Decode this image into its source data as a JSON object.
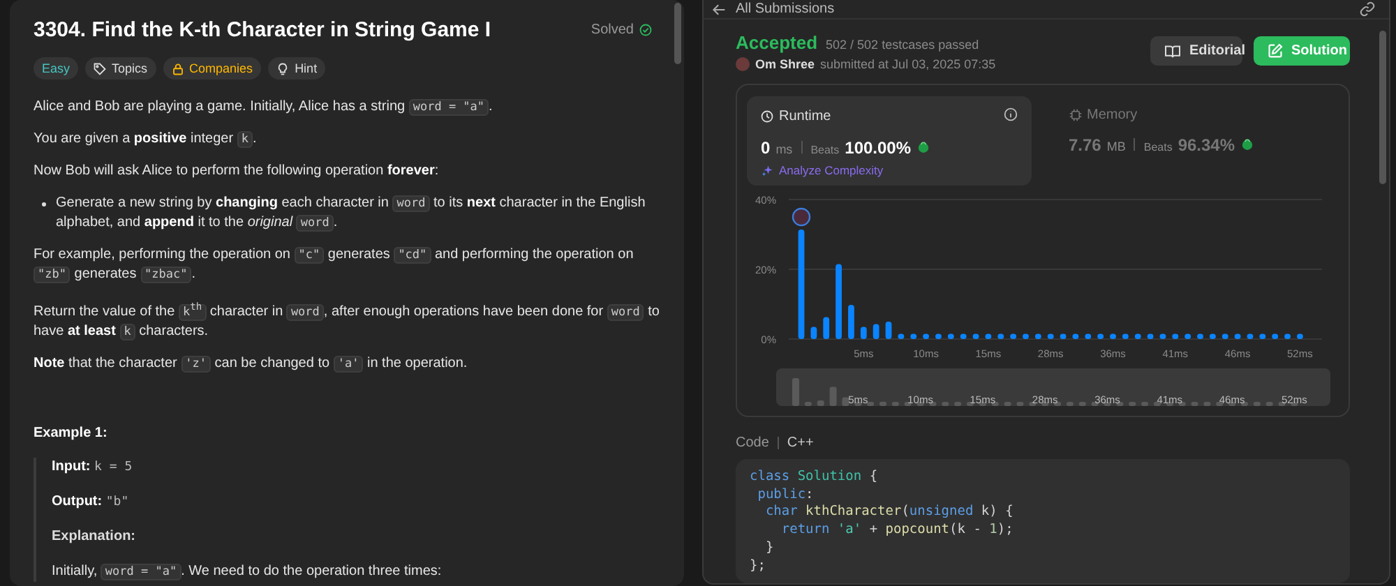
{
  "problem": {
    "title": "3304. Find the K-th Character in String Game I",
    "status": "Solved",
    "tags": [
      {
        "label": "Easy",
        "kind": "difficulty"
      },
      {
        "label": "Topics",
        "kind": "topics"
      },
      {
        "label": "Companies",
        "kind": "companies"
      },
      {
        "label": "Hint",
        "kind": "hint"
      }
    ],
    "description": [
      {
        "kind": "paragraph",
        "segments": [
          {
            "kind": "text",
            "text": "Alice and Bob are playing a game. Initially, Alice has a string "
          },
          {
            "kind": "code",
            "text": "word = \"a\""
          },
          {
            "kind": "text",
            "text": "."
          }
        ]
      },
      {
        "kind": "paragraph",
        "segments": [
          {
            "kind": "text",
            "text": "You are given a **positive** integer "
          },
          {
            "kind": "code",
            "text": "k"
          },
          {
            "kind": "text",
            "text": "."
          }
        ]
      },
      {
        "kind": "paragraph",
        "segments": [
          {
            "kind": "text",
            "text": "Now Bob will ask Alice to perform the following operation **forever**:"
          }
        ]
      },
      {
        "kind": "bullet",
        "segments": [
          {
            "kind": "text",
            "text": "Generate a new string by **changing** each character in "
          },
          {
            "kind": "code",
            "text": "word"
          },
          {
            "kind": "text",
            "text": " to its **next** character in the English alphabet, and **append** it to the *original* "
          },
          {
            "kind": "code",
            "text": "word"
          },
          {
            "kind": "text",
            "text": "."
          }
        ]
      },
      {
        "kind": "paragraph",
        "segments": [
          {
            "kind": "text",
            "text": "For example, performing the operation on "
          },
          {
            "kind": "code",
            "text": "\"c\""
          },
          {
            "kind": "text",
            "text": " generates "
          },
          {
            "kind": "code",
            "text": "\"cd\""
          },
          {
            "kind": "text",
            "text": " and performing the operation on "
          },
          {
            "kind": "code",
            "text": "\"zb\""
          },
          {
            "kind": "text",
            "text": " generates "
          },
          {
            "kind": "code",
            "text": "\"zbac\""
          },
          {
            "kind": "text",
            "text": "."
          }
        ]
      },
      {
        "kind": "paragraph",
        "segments": [
          {
            "kind": "text",
            "text": "Return the value of the "
          },
          {
            "kind": "code",
            "text": "k$^{th}$"
          },
          {
            "kind": "text",
            "text": " character in "
          },
          {
            "kind": "code",
            "text": "word"
          },
          {
            "kind": "text",
            "text": ", after enough operations have been done for "
          },
          {
            "kind": "code",
            "text": "word"
          },
          {
            "kind": "text",
            "text": " to have **at least** "
          },
          {
            "kind": "code",
            "text": "k"
          },
          {
            "kind": "text",
            "text": " characters."
          }
        ]
      },
      {
        "kind": "paragraph",
        "segments": [
          {
            "kind": "text",
            "text": "**Note** that the character "
          },
          {
            "kind": "code",
            "text": "'z'"
          },
          {
            "kind": "text",
            "text": " can be changed to "
          },
          {
            "kind": "code",
            "text": "'a'"
          },
          {
            "kind": "text",
            "text": " in the operation."
          }
        ]
      }
    ],
    "example": {
      "title": "Example 1:",
      "lines": [
        {
          "kind": "paragraph",
          "segments": [
            {
              "kind": "text",
              "text": "**Input:** "
            },
            {
              "kind": "mono",
              "text": "k = 5"
            }
          ]
        },
        {
          "kind": "paragraph",
          "segments": [
            {
              "kind": "text",
              "text": "**Output:** "
            },
            {
              "kind": "mono",
              "text": "\"b\""
            }
          ]
        },
        {
          "kind": "label",
          "segments": [
            {
              "kind": "text",
              "text": "Explanation:"
            }
          ]
        },
        {
          "kind": "paragraph",
          "segments": [
            {
              "kind": "text",
              "text": "Initially, "
            },
            {
              "kind": "code",
              "text": "word = \"a\""
            },
            {
              "kind": "text",
              "text": ". We need to do the operation three times:"
            }
          ]
        }
      ]
    }
  },
  "submission": {
    "back_link": "All Submissions",
    "verdict": "Accepted",
    "testcases": "502 / 502 testcases passed",
    "author": "Om Shree",
    "submitted": "submitted at Jul 03, 2025 07:35",
    "buttons": [
      {
        "label": "Editorial",
        "kind": "secondary"
      },
      {
        "label": "Solution",
        "kind": "primary"
      }
    ],
    "metrics": [
      {
        "kind": "runtime",
        "label": "Runtime",
        "value": "0",
        "unit": "ms",
        "beats_label": "Beats",
        "beats": "100.00%",
        "selected": true,
        "action": "Analyze Complexity"
      },
      {
        "kind": "memory",
        "label": "Memory",
        "value": "7.76",
        "unit": "MB",
        "beats_label": "Beats",
        "beats": "96.34%",
        "selected": false
      }
    ],
    "chart_data": {
      "type": "bar",
      "values": [
        31.4,
        3.5,
        6.3,
        21.5,
        9.8,
        3.5,
        4.3,
        5,
        1.5,
        1.5,
        1.5,
        1.5,
        1.5,
        1.5,
        1.5,
        1.5,
        1.5,
        1.5,
        1.5,
        1.5,
        1.5,
        1.5,
        1.5,
        1.5,
        1.5,
        1.5,
        1.5,
        1.5,
        1.5,
        1.5,
        1.5,
        1.5,
        1.5,
        1.5,
        1.5,
        1.5,
        1.5,
        1.5,
        1.5,
        1.5,
        1.5
      ],
      "categories": [
        null,
        null,
        null,
        null,
        null,
        "5ms",
        null,
        null,
        null,
        null,
        "10ms",
        null,
        null,
        null,
        null,
        "15ms",
        null,
        null,
        null,
        null,
        "28ms",
        null,
        null,
        null,
        null,
        "36ms",
        null,
        null,
        null,
        null,
        "41ms",
        null,
        null,
        null,
        null,
        "46ms",
        null,
        null,
        null,
        null,
        "52ms"
      ],
      "ylim": [
        0,
        40
      ],
      "yticks": [
        {
          "value": 0,
          "label": "0%"
        },
        {
          "value": 20,
          "label": "20%"
        },
        {
          "value": 40,
          "label": "40%"
        }
      ]
    },
    "range_selector": {
      "labels": [
        "5ms",
        "10ms",
        "15ms",
        "28ms",
        "36ms",
        "41ms",
        "46ms",
        "52ms"
      ]
    },
    "code": {
      "label": "Code",
      "language": "C++",
      "lines": [
        [
          {
            "text": "class",
            "kind": "keyword"
          },
          {
            "text": " Solution",
            "kind": "type"
          },
          {
            "text": " {",
            "kind": "plain"
          }
        ],
        [
          {
            "text": " public",
            "kind": "keyword"
          },
          {
            "text": ":",
            "kind": "plain"
          }
        ],
        [
          {
            "text": "  char",
            "kind": "keyword"
          },
          {
            "text": " kthCharacter",
            "kind": "function"
          },
          {
            "text": "(",
            "kind": "plain"
          },
          {
            "text": "unsigned",
            "kind": "keyword"
          },
          {
            "text": " k) {",
            "kind": "plain"
          }
        ],
        [
          {
            "text": "    return",
            "kind": "keyword"
          },
          {
            "text": " 'a'",
            "kind": "string"
          },
          {
            "text": " + ",
            "kind": "plain"
          },
          {
            "text": "popcount",
            "kind": "function"
          },
          {
            "text": "(k - ",
            "kind": "plain"
          },
          {
            "text": "1",
            "kind": "number"
          },
          {
            "text": ");",
            "kind": "plain"
          }
        ],
        [
          {
            "text": "  }",
            "kind": "plain"
          }
        ],
        [
          {
            "text": "};",
            "kind": "plain"
          }
        ]
      ]
    }
  }
}
